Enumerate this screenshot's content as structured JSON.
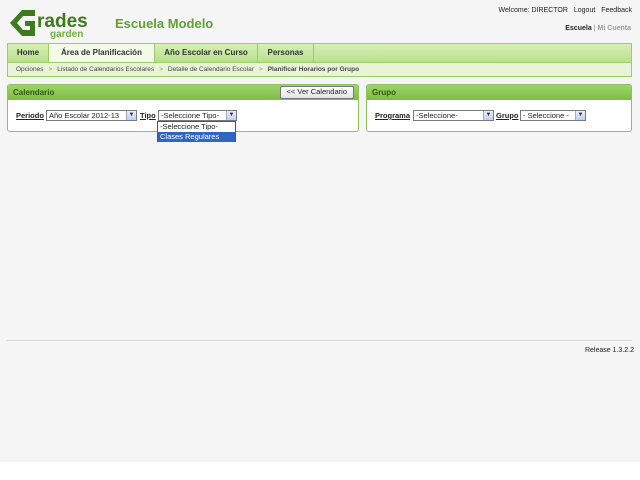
{
  "logo": {
    "word1": "rades",
    "word2": "garden"
  },
  "header": {
    "school_name": "Escuela Modelo",
    "welcome": "Welcome: DIRECTOR",
    "logout": "Logout",
    "feedback": "Feedback",
    "school_link": "Escuela",
    "separator": "|",
    "account_link": "Mi Cuenta"
  },
  "nav": {
    "tabs": [
      {
        "label": "Home"
      },
      {
        "label": "Área de Planificación"
      },
      {
        "label": "Año Escolar en Curso"
      },
      {
        "label": "Personas"
      }
    ],
    "active_tab": 1
  },
  "breadcrumb": {
    "items": [
      "Opciones",
      "Listado de Calendarios Escolares",
      "Detalle de Calendario Escolar"
    ],
    "current": "Planificar Horarios por Grupo",
    "separator": ">"
  },
  "calendario": {
    "title": "Calendario",
    "back_button": "<< Ver Calendario",
    "periodo_label": "Periodo",
    "periodo_value": "Año Escolar 2012-13",
    "tipo_label": "Tipo",
    "tipo_value": "-Seleccione Tipo-",
    "tipo_options": [
      "-Seleccione Tipo-",
      "Clases Regulares"
    ],
    "tipo_highlighted": 1
  },
  "grupo": {
    "title": "Grupo",
    "programa_label": "Programa",
    "programa_value": "-Seleccione-",
    "grupo_label": "Grupo",
    "grupo_value": "- Seleccione -"
  },
  "footer": {
    "release": "Release 1.3.2.2"
  },
  "colors": {
    "accent": "#5e9e35",
    "nav_bg": "#c6e8a0",
    "highlight": "#3165c4",
    "logo_dark": "#3f7a1e"
  },
  "icons": {
    "select_arrow": "chevron-down-icon"
  }
}
